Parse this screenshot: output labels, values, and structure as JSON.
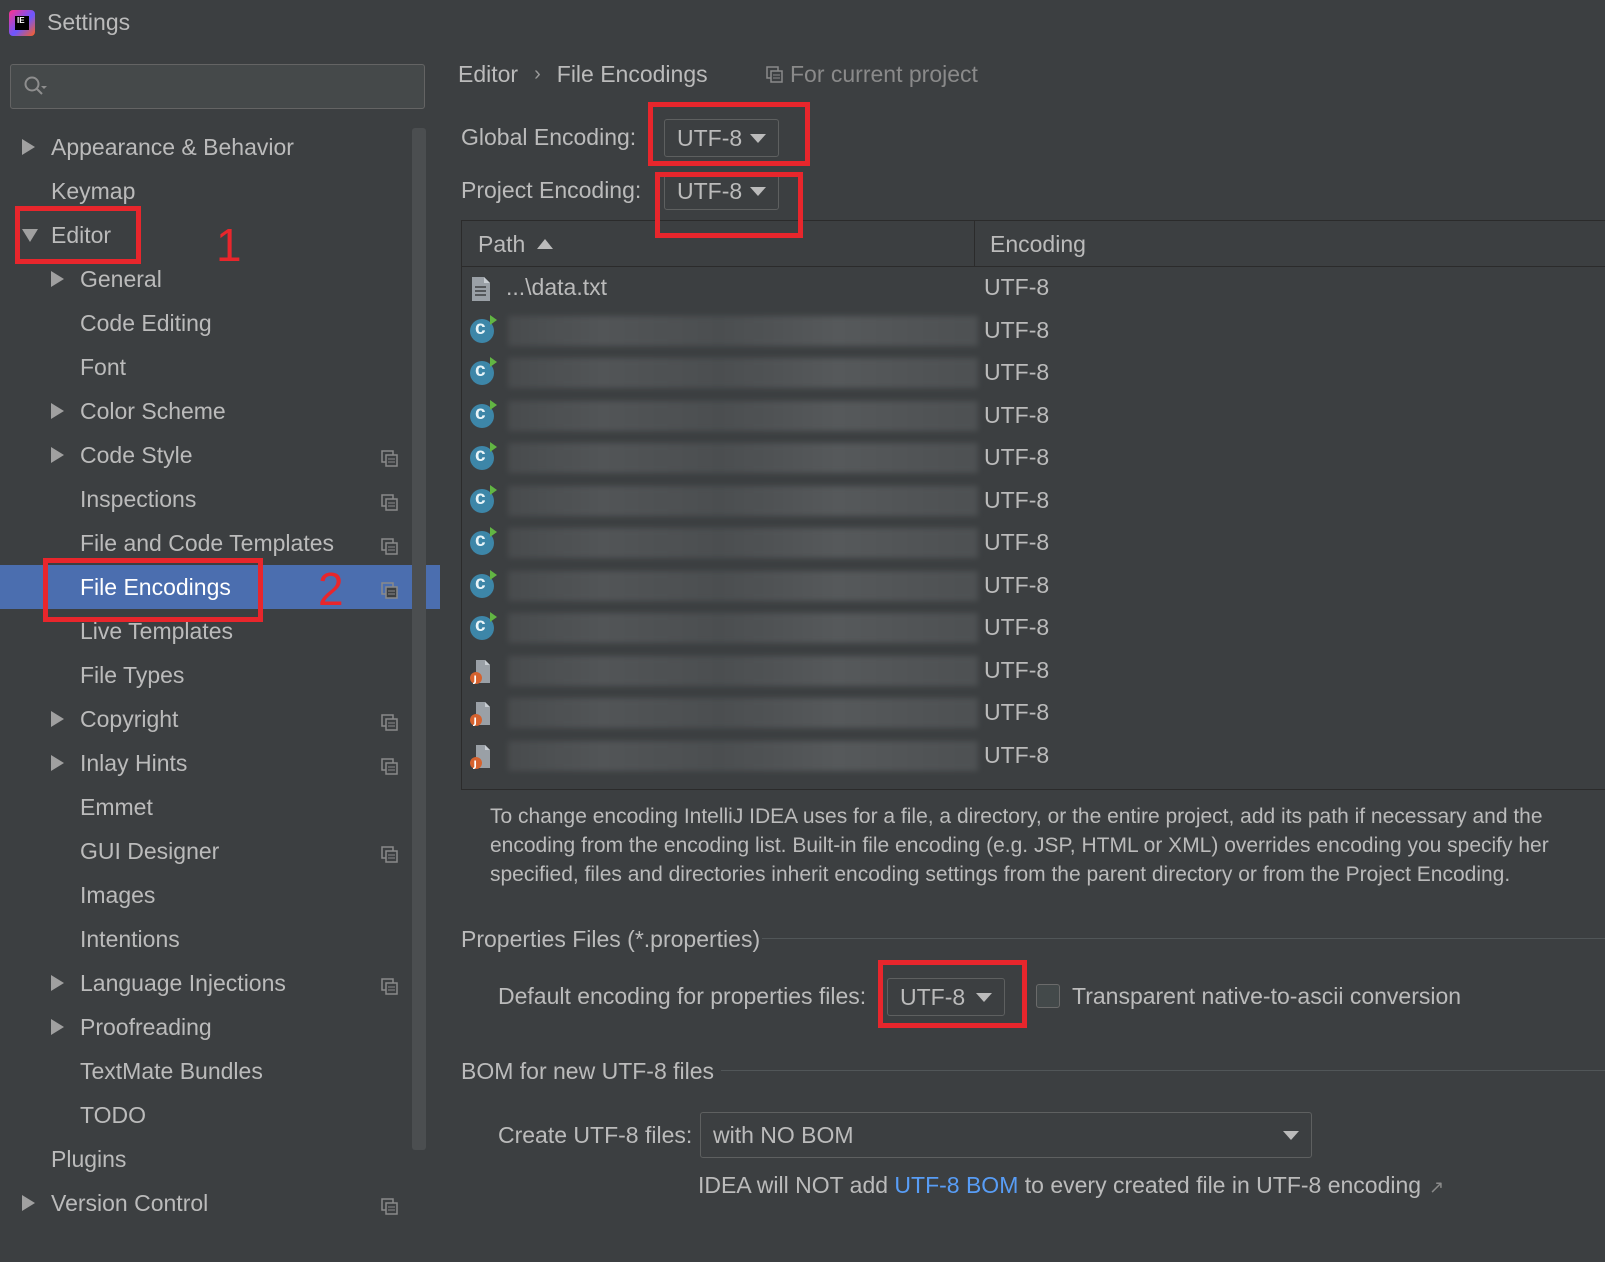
{
  "window": {
    "title": "Settings",
    "app_icon_text": "IE"
  },
  "search": {
    "placeholder": ""
  },
  "sidebar": {
    "items": [
      {
        "label": "Appearance & Behavior",
        "level": 0,
        "arrow": "right",
        "project": false
      },
      {
        "label": "Keymap",
        "level": 0,
        "arrow": "none",
        "project": false
      },
      {
        "label": "Editor",
        "level": 0,
        "arrow": "down",
        "project": false
      },
      {
        "label": "General",
        "level": 1,
        "arrow": "right",
        "project": false
      },
      {
        "label": "Code Editing",
        "level": 1,
        "arrow": "none",
        "project": false
      },
      {
        "label": "Font",
        "level": 1,
        "arrow": "none",
        "project": false
      },
      {
        "label": "Color Scheme",
        "level": 1,
        "arrow": "right",
        "project": false
      },
      {
        "label": "Code Style",
        "level": 1,
        "arrow": "right",
        "project": true
      },
      {
        "label": "Inspections",
        "level": 1,
        "arrow": "none",
        "project": true
      },
      {
        "label": "File and Code Templates",
        "level": 1,
        "arrow": "none",
        "project": true
      },
      {
        "label": "File Encodings",
        "level": 1,
        "arrow": "none",
        "project": true,
        "selected": true
      },
      {
        "label": "Live Templates",
        "level": 1,
        "arrow": "none",
        "project": false
      },
      {
        "label": "File Types",
        "level": 1,
        "arrow": "none",
        "project": false
      },
      {
        "label": "Copyright",
        "level": 1,
        "arrow": "right",
        "project": true
      },
      {
        "label": "Inlay Hints",
        "level": 1,
        "arrow": "right",
        "project": true
      },
      {
        "label": "Emmet",
        "level": 1,
        "arrow": "none",
        "project": false
      },
      {
        "label": "GUI Designer",
        "level": 1,
        "arrow": "none",
        "project": true
      },
      {
        "label": "Images",
        "level": 1,
        "arrow": "none",
        "project": false
      },
      {
        "label": "Intentions",
        "level": 1,
        "arrow": "none",
        "project": false
      },
      {
        "label": "Language Injections",
        "level": 1,
        "arrow": "right",
        "project": true
      },
      {
        "label": "Proofreading",
        "level": 1,
        "arrow": "right",
        "project": false
      },
      {
        "label": "TextMate Bundles",
        "level": 1,
        "arrow": "none",
        "project": false
      },
      {
        "label": "TODO",
        "level": 1,
        "arrow": "none",
        "project": false
      },
      {
        "label": "Plugins",
        "level": 0,
        "arrow": "none",
        "project": false
      },
      {
        "label": "Version Control",
        "level": 0,
        "arrow": "right",
        "project": true
      }
    ]
  },
  "annotations": {
    "one": "1",
    "two": "2"
  },
  "header": {
    "crumb_parent": "Editor",
    "crumb_sep": "›",
    "crumb_current": "File Encodings",
    "for_project": "For current project"
  },
  "encoding": {
    "global_label": "Global Encoding:",
    "global_value": "UTF-8",
    "project_label": "Project Encoding:",
    "project_value": "UTF-8"
  },
  "table": {
    "col_path": "Path",
    "col_encoding": "Encoding",
    "rows": [
      {
        "icon": "text-file",
        "path": "...\\data.txt",
        "encoding": "UTF-8",
        "blurred": false
      },
      {
        "icon": "class-file",
        "path": "",
        "encoding": "UTF-8",
        "blurred": true
      },
      {
        "icon": "class-file",
        "path": "",
        "encoding": "UTF-8",
        "blurred": true
      },
      {
        "icon": "class-file",
        "path": "",
        "encoding": "UTF-8",
        "blurred": true
      },
      {
        "icon": "class-file",
        "path": "",
        "encoding": "UTF-8",
        "blurred": true
      },
      {
        "icon": "class-file",
        "path": "",
        "encoding": "UTF-8",
        "blurred": true
      },
      {
        "icon": "class-file",
        "path": "",
        "encoding": "UTF-8",
        "blurred": true
      },
      {
        "icon": "class-file",
        "path": "",
        "encoding": "UTF-8",
        "blurred": true
      },
      {
        "icon": "class-file",
        "path": "",
        "encoding": "UTF-8",
        "blurred": true
      },
      {
        "icon": "java-file",
        "path": "",
        "encoding": "UTF-8",
        "blurred": true
      },
      {
        "icon": "java-file",
        "path": "",
        "encoding": "UTF-8",
        "blurred": true
      },
      {
        "icon": "java-file",
        "path": "",
        "encoding": "UTF-8",
        "blurred": true
      }
    ]
  },
  "description": "To change encoding IntelliJ IDEA uses for a file, a directory, or the entire project, add its path if necessary and the encoding from the encoding list. Built-in file encoding (e.g. JSP, HTML or XML) overrides encoding you specify her specified, files and directories inherit encoding settings from the parent directory or from the Project Encoding.",
  "properties": {
    "section": "Properties Files (*.properties)",
    "default_label": "Default encoding for properties files:",
    "default_value": "UTF-8",
    "transparent_label": "Transparent native-to-ascii conversion",
    "transparent_checked": false
  },
  "bom": {
    "section": "BOM for new UTF-8 files",
    "create_label": "Create UTF-8 files:",
    "create_value": "with NO BOM",
    "note_pre": "IDEA will NOT add ",
    "note_link": "UTF-8 BOM",
    "note_post": " to every created file in UTF-8 encoding",
    "note_arrow": "↗"
  },
  "colors": {
    "background": "#3c3f41",
    "selection": "#4b6eaf",
    "annotation_red": "#e8262c",
    "link": "#589df6"
  }
}
